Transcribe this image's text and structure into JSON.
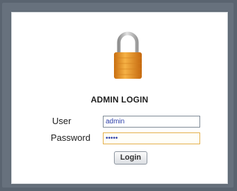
{
  "login": {
    "title": "ADMIN LOGIN",
    "user_label": "User",
    "user_value": "admin",
    "password_label": "Password",
    "password_value": "•••••",
    "login_button": "Login"
  },
  "icons": {
    "lock": "padlock-icon"
  },
  "colors": {
    "lock_body": "#e8951f",
    "lock_shackle": "#b9b9b9",
    "password_focus_border": "#e4b04a",
    "input_text": "#2c3ea8"
  }
}
